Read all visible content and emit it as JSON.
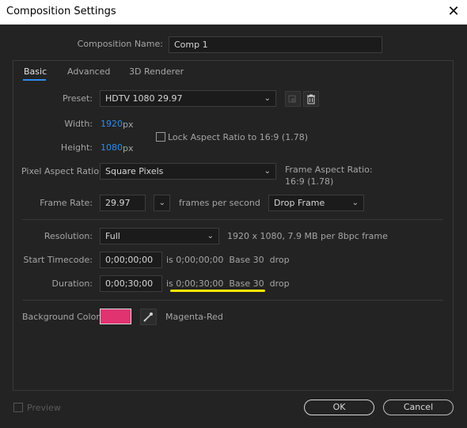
{
  "window": {
    "title": "Composition Settings"
  },
  "composition": {
    "name_label": "Composition Name:",
    "name_value": "Comp 1"
  },
  "tabs": [
    {
      "label": "Basic"
    },
    {
      "label": "Advanced"
    },
    {
      "label": "3D Renderer"
    }
  ],
  "preset": {
    "label": "Preset:",
    "value": "HDTV 1080 29.97"
  },
  "width": {
    "label": "Width:",
    "value": "1920",
    "unit": "px"
  },
  "height": {
    "label": "Height:",
    "value": "1080",
    "unit": "px"
  },
  "lock_aspect": {
    "label": "Lock Aspect Ratio to 16:9 (1.78)",
    "checked": false
  },
  "pixel_aspect": {
    "label": "Pixel Aspect Ratio:",
    "value": "Square Pixels"
  },
  "frame_aspect": {
    "label": "Frame Aspect Ratio:",
    "value": "16:9 (1.78)"
  },
  "frame_rate": {
    "label": "Frame Rate:",
    "value": "29.97",
    "unit": "frames per second",
    "drop_value": "Drop Frame"
  },
  "resolution": {
    "label": "Resolution:",
    "value": "Full",
    "info": "1920 x 1080, 7.9 MB per 8bpc frame"
  },
  "start_timecode": {
    "label": "Start Timecode:",
    "value": "0;00;00;00",
    "is_text": "is 0;00;00;00  Base 30  drop"
  },
  "duration": {
    "label": "Duration:",
    "value": "0;00;30;00",
    "is_text": "is 0;00;30;00  Base 30  drop"
  },
  "background": {
    "label": "Background Color:",
    "color": "#e0336f",
    "name": "Magenta-Red"
  },
  "footer": {
    "preview_label": "Preview",
    "ok_label": "OK",
    "cancel_label": "Cancel"
  },
  "colors": {
    "accent": "#2d8ceb",
    "highlight": "#ffe900",
    "background": "#232323"
  }
}
